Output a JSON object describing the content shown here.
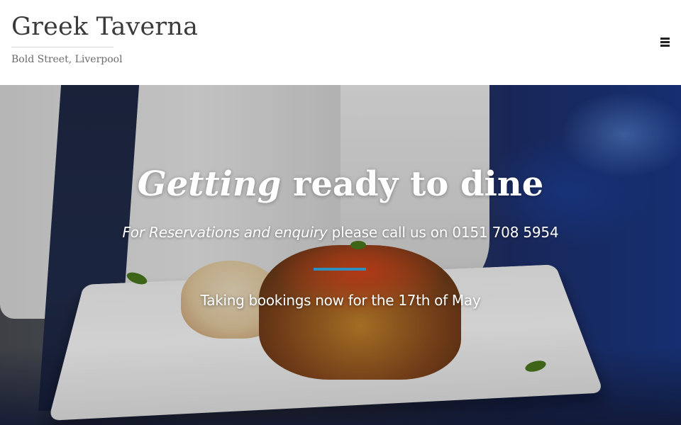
{
  "header": {
    "site_title": "Greek Taverna",
    "tagline": "Bold Street, Liverpool",
    "menu_icon": "hamburger-menu-icon"
  },
  "hero": {
    "heading_emphasis": "Getting",
    "heading_rest": " ready to dine",
    "subline_emphasis": "For Reservations and enquiry",
    "subline_rest": " please call us on 0151 708 5954",
    "note": "Taking bookings now for the 17th of May",
    "divider_color": "#2f8fbf",
    "background_image": "waiter-holding-plate-of-moussaka-and-rice"
  }
}
